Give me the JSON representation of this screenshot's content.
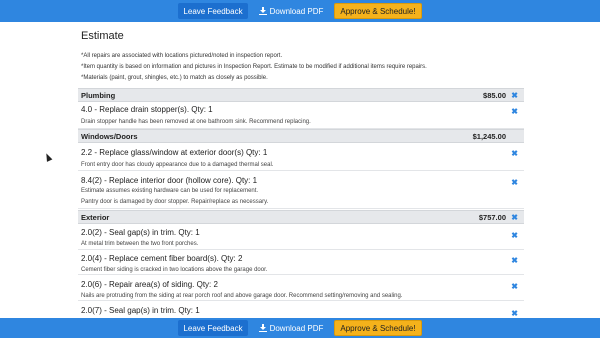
{
  "toolbar": {
    "feedback_label": "Leave Feedback",
    "pdf_label": "Download PDF",
    "approve_label": "Approve & Schedule!"
  },
  "estimate": {
    "title": "Estimate",
    "notes": [
      "*All repairs are associated with locations pictured/noted in inspection report.",
      "*Item quantity is based on information and pictures in Inspection Report. Estimate to be modified if additional items require repairs.",
      "*Materials (paint, grout, shingles, etc.) to match as closely as possible."
    ]
  },
  "sections": [
    {
      "name": "Plumbing",
      "amount": "$85.00",
      "items": [
        {
          "title": "4.0 - Replace drain stopper(s). Qty: 1",
          "desc": [
            "Drain stopper handle has been removed at one bathroom sink. Recommend replacing."
          ]
        }
      ]
    },
    {
      "name": "Windows/Doors",
      "amount": "$1,245.00",
      "items": [
        {
          "title": "2.2 - Replace glass/window at exterior door(s) Qty: 1",
          "desc": [
            "Front entry door has cloudy appearance due to a damaged thermal seal."
          ]
        },
        {
          "title": "8.4(2) - Replace interior door (hollow core). Qty: 1",
          "desc": [
            "Estimate assumes existing hardware can be used for replacement.",
            "Pantry door is damaged by door stopper. Repair/replace as necessary."
          ]
        }
      ]
    },
    {
      "name": "Exterior",
      "amount": "$757.00",
      "items": [
        {
          "title": "2.0(2) - Seal gap(s) in trim. Qty: 1",
          "desc": [
            "At metal trim between the two front porches."
          ]
        },
        {
          "title": "2.0(4) - Replace cement fiber board(s). Qty: 2",
          "desc": [
            "Cement fiber siding is cracked in two locations above the garage door."
          ]
        },
        {
          "title": "2.0(6) - Repair area(s) of siding. Qty: 2",
          "desc": [
            "Nails are protruding from the siding at rear porch roof and above garage door. Recommend setting/removing and sealing."
          ]
        },
        {
          "title": "2.0(7) - Seal gap(s) in trim. Qty: 1",
          "desc": []
        }
      ]
    }
  ],
  "icons": {
    "remove": "close-icon",
    "download": "download-icon"
  },
  "colors": {
    "toolbar": "#2f86e0",
    "approve": "#f5b21b",
    "remove": "#2f86e0"
  }
}
